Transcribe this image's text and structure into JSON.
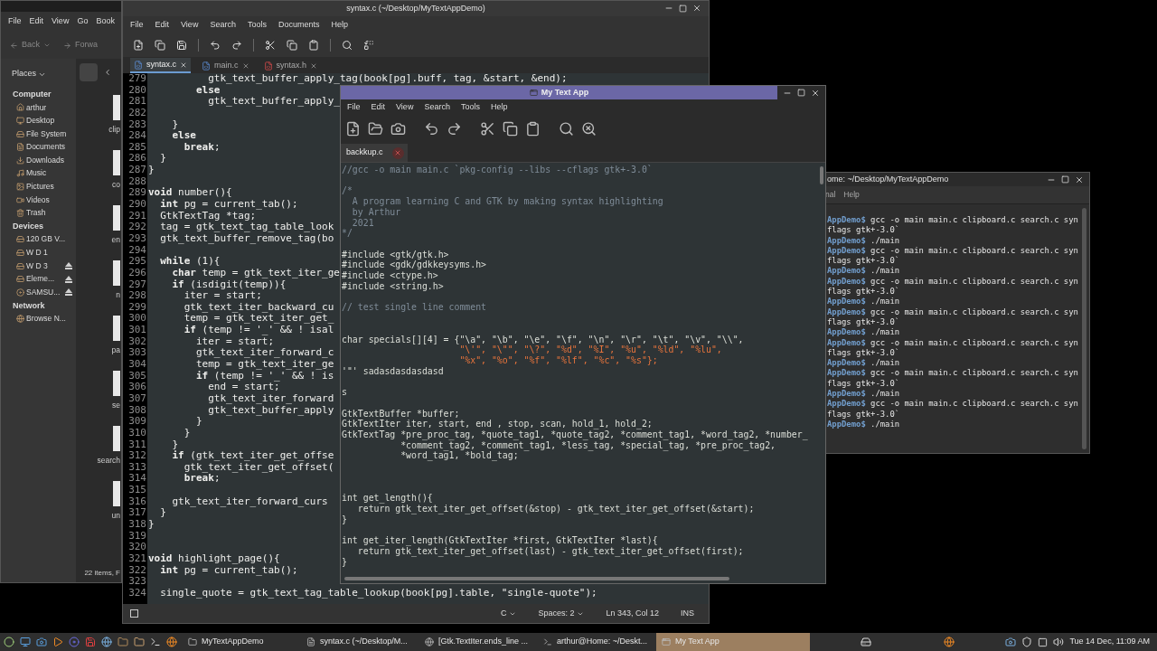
{
  "file_manager": {
    "menu": [
      "File",
      "Edit",
      "View",
      "Go",
      "Book"
    ],
    "toolbar": [
      "Back",
      "Forwa"
    ],
    "places_label": "Places",
    "sidebar": [
      {
        "heading": "Computer",
        "items": [
          {
            "label": "arthur",
            "kind": "home",
            "ejectable": false
          },
          {
            "label": "Desktop",
            "kind": "desktop",
            "ejectable": false
          },
          {
            "label": "File System",
            "kind": "drive",
            "ejectable": false
          },
          {
            "label": "Documents",
            "kind": "documents",
            "ejectable": false
          },
          {
            "label": "Downloads",
            "kind": "downloads",
            "ejectable": false
          },
          {
            "label": "Music",
            "kind": "music",
            "ejectable": false
          },
          {
            "label": "Pictures",
            "kind": "pictures",
            "ejectable": false
          },
          {
            "label": "Videos",
            "kind": "videos",
            "ejectable": false
          },
          {
            "label": "Trash",
            "kind": "trash",
            "ejectable": false
          }
        ]
      },
      {
        "heading": "Devices",
        "items": [
          {
            "label": "120 GB V...",
            "kind": "drive",
            "ejectable": false
          },
          {
            "label": "W D 1",
            "kind": "drive",
            "ejectable": false
          },
          {
            "label": "W D 3",
            "kind": "drive",
            "ejectable": true
          },
          {
            "label": "Eleme...",
            "kind": "drive",
            "ejectable": true
          },
          {
            "label": "SAMSU...",
            "kind": "disc",
            "ejectable": true
          }
        ]
      },
      {
        "heading": "Network",
        "items": [
          {
            "label": "Browse N...",
            "kind": "network",
            "ejectable": false
          }
        ]
      }
    ],
    "files": [
      "clip",
      "co",
      "en",
      "n",
      "pa",
      "se",
      "search",
      "un"
    ],
    "status": "22 items, F"
  },
  "gedit": {
    "title": "syntax.c (~/Desktop/MyTextAppDemo)",
    "menu": [
      "File",
      "Edit",
      "View",
      "Search",
      "Tools",
      "Documents",
      "Help"
    ],
    "tabs": [
      {
        "label": "syntax.c",
        "kind": "c",
        "selected": true
      },
      {
        "label": "main.c",
        "kind": "c",
        "selected": false
      },
      {
        "label": "syntax.h",
        "kind": "h",
        "selected": false
      }
    ],
    "lines": [
      {
        "no": "279",
        "text": "          gtk_text_buffer_apply_tag(book[pg].buff, tag, &start, &end);"
      },
      {
        "no": "280",
        "text": "        **else**"
      },
      {
        "no": "281",
        "text": "          gtk_text_buffer_apply_"
      },
      {
        "no": "282"
      },
      {
        "no": "283",
        "text": "    }"
      },
      {
        "no": "284",
        "text": "    **else**"
      },
      {
        "no": "285",
        "text": "      **break**;"
      },
      {
        "no": "286",
        "text": "  }"
      },
      {
        "no": "287",
        "text": "}"
      },
      {
        "no": "288"
      },
      {
        "no": "289",
        "text": "**void** number(){"
      },
      {
        "no": "290",
        "text": "  **int** pg = current_tab();"
      },
      {
        "no": "291",
        "text": "  GtkTextTag *tag;"
      },
      {
        "no": "292",
        "text": "  tag = gtk_text_tag_table_look"
      },
      {
        "no": "293",
        "text": "  gtk_text_buffer_remove_tag(bo"
      },
      {
        "no": "294"
      },
      {
        "no": "295",
        "text": "  **while** (1){"
      },
      {
        "no": "296",
        "text": "    **char** temp = gtk_text_iter_ge"
      },
      {
        "no": "297",
        "text": "    **if** (isdigit(temp)){"
      },
      {
        "no": "298",
        "text": "      iter = start;"
      },
      {
        "no": "299",
        "text": "      gtk_text_iter_backward_cu"
      },
      {
        "no": "300",
        "text": "      temp = gtk_text_iter_get_"
      },
      {
        "no": "301",
        "text": "      **if** (temp != '_' && ! isal"
      },
      {
        "no": "302",
        "text": "        iter = start;"
      },
      {
        "no": "303",
        "text": "        gtk_text_iter_forward_c"
      },
      {
        "no": "304",
        "text": "        temp = gtk_text_iter_ge"
      },
      {
        "no": "305",
        "text": "        **if** (temp != '_' && ! is"
      },
      {
        "no": "306",
        "text": "          end = start;"
      },
      {
        "no": "307",
        "text": "          gtk_text_iter_forward"
      },
      {
        "no": "308",
        "text": "          gtk_text_buffer_apply"
      },
      {
        "no": "309",
        "text": "        }"
      },
      {
        "no": "310",
        "text": "      }"
      },
      {
        "no": "311",
        "text": "    }"
      },
      {
        "no": "312",
        "text": "    **if** (gtk_text_iter_get_offse"
      },
      {
        "no": "313",
        "text": "      gtk_text_iter_get_offset("
      },
      {
        "no": "314",
        "text": "      **break**;"
      },
      {
        "no": "315"
      },
      {
        "no": "316",
        "text": "    gtk_text_iter_forward_curs"
      },
      {
        "no": "317",
        "text": "  }"
      },
      {
        "no": "318",
        "text": "}"
      },
      {
        "no": "319"
      },
      {
        "no": "320"
      },
      {
        "no": "321",
        "text": "**void** highlight_page(){"
      },
      {
        "no": "322",
        "text": "  **int** pg = current_tab();"
      },
      {
        "no": "323"
      },
      {
        "no": "324",
        "text": "  single_quote = gtk_text_tag_table_lookup(book[pg].table, \"single-quote\");"
      }
    ],
    "status": {
      "language": "C",
      "spaces": "Spaces: 2",
      "position": "Ln 343, Col 12",
      "mode": "INS"
    }
  },
  "terminal": {
    "title": "ome: ~/Desktop/MyTextAppDemo",
    "menu": [
      "nal",
      "Help"
    ],
    "lines": [
      {
        "kind": "prompt",
        "prompt": "AppDemo$",
        "text": " gcc -o main main.c clipboard.c search.c syn"
      },
      {
        "kind": "output",
        "text": "flags gtk+-3.0`"
      },
      {
        "kind": "prompt",
        "prompt": "AppDemo$",
        "text": " ./main"
      },
      {
        "kind": "prompt",
        "prompt": "AppDemo$",
        "text": " gcc -o main main.c clipboard.c search.c syn"
      },
      {
        "kind": "output",
        "text": "flags gtk+-3.0`"
      },
      {
        "kind": "prompt",
        "prompt": "AppDemo$",
        "text": " ./main"
      },
      {
        "kind": "prompt",
        "prompt": "AppDemo$",
        "text": " gcc -o main main.c clipboard.c search.c syn"
      },
      {
        "kind": "output",
        "text": "flags gtk+-3.0`"
      },
      {
        "kind": "prompt",
        "prompt": "AppDemo$",
        "text": " ./main"
      },
      {
        "kind": "prompt",
        "prompt": "AppDemo$",
        "text": " gcc -o main main.c clipboard.c search.c syn"
      },
      {
        "kind": "output",
        "text": "flags gtk+-3.0`"
      },
      {
        "kind": "prompt",
        "prompt": "AppDemo$",
        "text": " ./main"
      },
      {
        "kind": "prompt",
        "prompt": "AppDemo$",
        "text": " gcc -o main main.c clipboard.c search.c syn"
      },
      {
        "kind": "output",
        "text": "flags gtk+-3.0`"
      },
      {
        "kind": "prompt",
        "prompt": "AppDemo$",
        "text": " ./main"
      },
      {
        "kind": "prompt",
        "prompt": "AppDemo$",
        "text": " gcc -o main main.c clipboard.c search.c syn"
      },
      {
        "kind": "output",
        "text": "flags gtk+-3.0`"
      },
      {
        "kind": "prompt",
        "prompt": "AppDemo$",
        "text": " ./main"
      },
      {
        "kind": "prompt",
        "prompt": "AppDemo$",
        "text": " gcc -o main main.c clipboard.c search.c syn"
      },
      {
        "kind": "output",
        "text": "flags gtk+-3.0`"
      },
      {
        "kind": "prompt",
        "prompt": "AppDemo$",
        "text": " ./main"
      }
    ]
  },
  "text_app": {
    "title": "My Text App",
    "menu": [
      "File",
      "Edit",
      "View",
      "Search",
      "Tools",
      "Help"
    ],
    "tabs": [
      {
        "label": "backkup.c",
        "selected": true
      }
    ],
    "lines": [
      {
        "kind": "comment",
        "text": "//gcc -o main main.c `pkg-config --libs --cflags gtk+-3.0`"
      },
      {
        "kind": "blank"
      },
      {
        "kind": "comment",
        "text": "/*"
      },
      {
        "kind": "comment",
        "text": "  A program learning C and GTK by making syntax highlighting"
      },
      {
        "kind": "comment",
        "text": "  by Arthur"
      },
      {
        "kind": "comment",
        "text": "  2021"
      },
      {
        "kind": "comment",
        "text": "*/"
      },
      {
        "kind": "blank"
      },
      {
        "kind": "code",
        "text": "#include <gtk/gtk.h>"
      },
      {
        "kind": "code",
        "text": "#include <gdk/gdkkeysyms.h>"
      },
      {
        "kind": "code",
        "text": "#include <ctype.h>"
      },
      {
        "kind": "code",
        "text": "#include <string.h>"
      },
      {
        "kind": "blank"
      },
      {
        "kind": "comment",
        "text": "// test single line comment"
      },
      {
        "kind": "blank"
      },
      {
        "kind": "blank"
      },
      {
        "kind": "code",
        "text": "char specials[][4] = {\"\\a\", \"\\b\", \"\\e\", \"\\f\", \"\\n\", \"\\r\", \"\\t\", \"\\v\", \"\\\\\","
      },
      {
        "kind": "string",
        "text": "                      \"\\'\", \"\\\"\", \"\\?\", \"%d\", \"%I\", \"%u\", \"%ld\", \"%lu\","
      },
      {
        "kind": "string",
        "text": "                      \"%x\", \"%o\", \"%f\", \"%lf\", \"%c\", \"%s\"};"
      },
      {
        "kind": "code",
        "text": "'\"' sadasdasdasdasd"
      },
      {
        "kind": "blank"
      },
      {
        "kind": "code",
        "text": "s"
      },
      {
        "kind": "blank"
      },
      {
        "kind": "code",
        "text": "GtkTextBuffer *buffer;"
      },
      {
        "kind": "code",
        "text": "GtkTextIter iter, start, end , stop, scan, hold_1, hold_2;"
      },
      {
        "kind": "code",
        "text": "GtkTextTag *pre_proc_tag, *quote_tag1, *quote_tag2, *comment_tag1, *word_tag2, *number_"
      },
      {
        "kind": "code",
        "text": "           *comment_tag2, *comment_tag1, *less_tag, *special_tag, *pre_proc_tag2,"
      },
      {
        "kind": "code",
        "text": "           *word_tag1, *bold_tag;"
      },
      {
        "kind": "blank"
      },
      {
        "kind": "blank"
      },
      {
        "kind": "blank"
      },
      {
        "kind": "code",
        "text": "int get_length(){"
      },
      {
        "kind": "code",
        "text": "   return gtk_text_iter_get_offset(&stop) - gtk_text_iter_get_offset(&start);"
      },
      {
        "kind": "code",
        "text": "}"
      },
      {
        "kind": "blank"
      },
      {
        "kind": "code",
        "text": "int get_iter_length(GtkTextIter *first, GtkTextIter *last){"
      },
      {
        "kind": "code",
        "text": "   return gtk_text_iter_get_offset(last) - gtk_text_iter_get_offset(first);"
      },
      {
        "kind": "code",
        "text": "}"
      }
    ]
  },
  "taskbar": {
    "tasks": [
      {
        "label": "MyTextAppDemo",
        "kind": "folder",
        "selected": false
      },
      {
        "label": "syntax.c (~/Desktop/M...",
        "kind": "editor",
        "selected": false
      },
      {
        "label": "[Gtk.TextIter.ends_line ...",
        "kind": "browser",
        "selected": false
      },
      {
        "label": "arthur@Home: ~/Deskt...",
        "kind": "terminal",
        "selected": false
      },
      {
        "label": "My Text App",
        "kind": "window",
        "selected": true
      }
    ],
    "clock": "Tue 14 Dec, 11:09 AM"
  }
}
